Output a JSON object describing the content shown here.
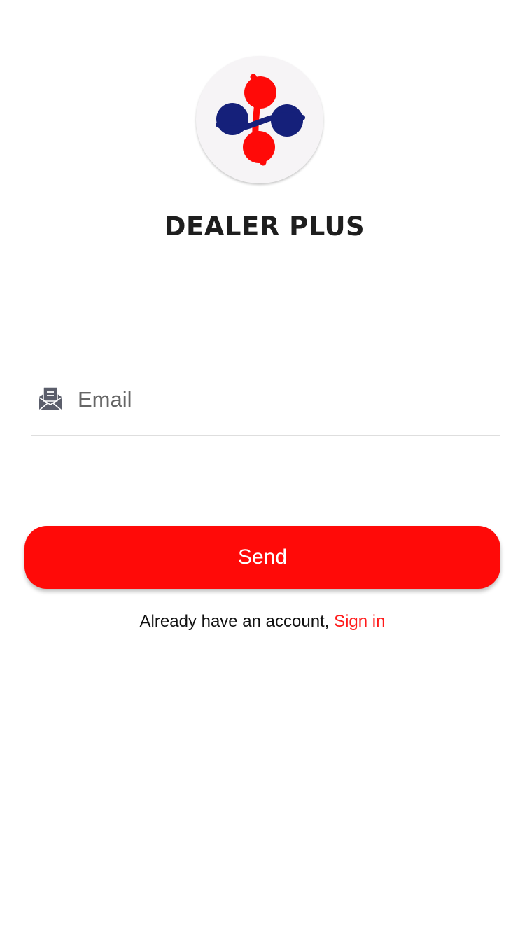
{
  "brand": {
    "title": "DEALER PLUS",
    "logo": "dealer-plus-logo",
    "colors": {
      "red": "#ff0a08",
      "navy": "#15207a"
    }
  },
  "form": {
    "email_icon": "envelope-open-icon",
    "email_placeholder": "Email",
    "email_value": ""
  },
  "actions": {
    "send_label": "Send",
    "send_color": "#ff0a08"
  },
  "footer": {
    "prompt_text": "Already have an account, ",
    "signin_label": "Sign in",
    "signin_color": "#ff1a1a"
  }
}
